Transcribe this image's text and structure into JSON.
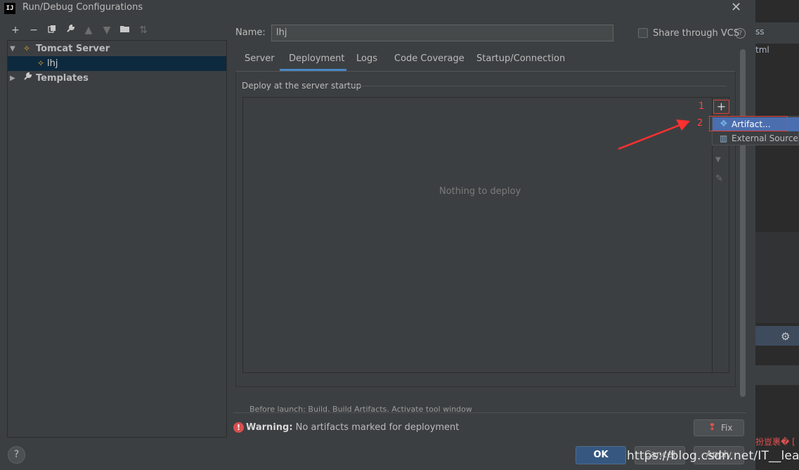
{
  "window": {
    "title": "Run/Debug Configurations",
    "logo_text": "IJ"
  },
  "toolbar": {
    "icons": [
      "plus-icon",
      "minus-icon",
      "copy-icon",
      "wrench-icon",
      "arrow-up-icon",
      "arrow-down-icon",
      "folder-icon",
      "sort-icon"
    ]
  },
  "tree": {
    "items": [
      {
        "label": "Tomcat Server",
        "level": 0,
        "expanded": true
      },
      {
        "label": "lhj",
        "level": 1,
        "selected": true
      },
      {
        "label": "Templates",
        "level": 0,
        "expanded": false
      }
    ]
  },
  "form": {
    "name_label": "Name:",
    "name_value": "lhj",
    "share_label": "Share through VCS",
    "share_checked": false,
    "help_glyph": "?"
  },
  "tabs": [
    {
      "label": "Server"
    },
    {
      "label": "Deployment",
      "active": true
    },
    {
      "label": "Logs"
    },
    {
      "label": "Code Coverage"
    },
    {
      "label": "Startup/Connection"
    }
  ],
  "deployment": {
    "section_title": "Deploy at the server startup",
    "empty_text": "Nothing to deploy",
    "plus_glyph": "+"
  },
  "popup_menu": {
    "items": [
      {
        "label": "Artifact...",
        "highlighted": true
      },
      {
        "label": "External Source..."
      }
    ]
  },
  "annotations": {
    "step1": "1",
    "step2": "2",
    "color": "#ff4040"
  },
  "clipped_text": "Before launch: Build, Build Artifacts, Activate tool window",
  "warning": {
    "label": "Warning:",
    "message": "No artifacts marked for deployment",
    "fix_label": "Fix"
  },
  "buttons": {
    "help": "?",
    "ok": "OK",
    "cancel": "Cancel",
    "apply": "Apply"
  },
  "background_ide": {
    "text1": "ss",
    "text2": "tml",
    "text3": "扮豈裹�  ["
  },
  "watermark": "https://blog.csdn.net/IT__learning",
  "colors": {
    "background": "#3c3f41",
    "selection": "#0d293e",
    "accent": "#4a88c7",
    "ok_button": "#365880",
    "popup_highlight": "#4b6eaf",
    "warning": "#d94f4f"
  }
}
